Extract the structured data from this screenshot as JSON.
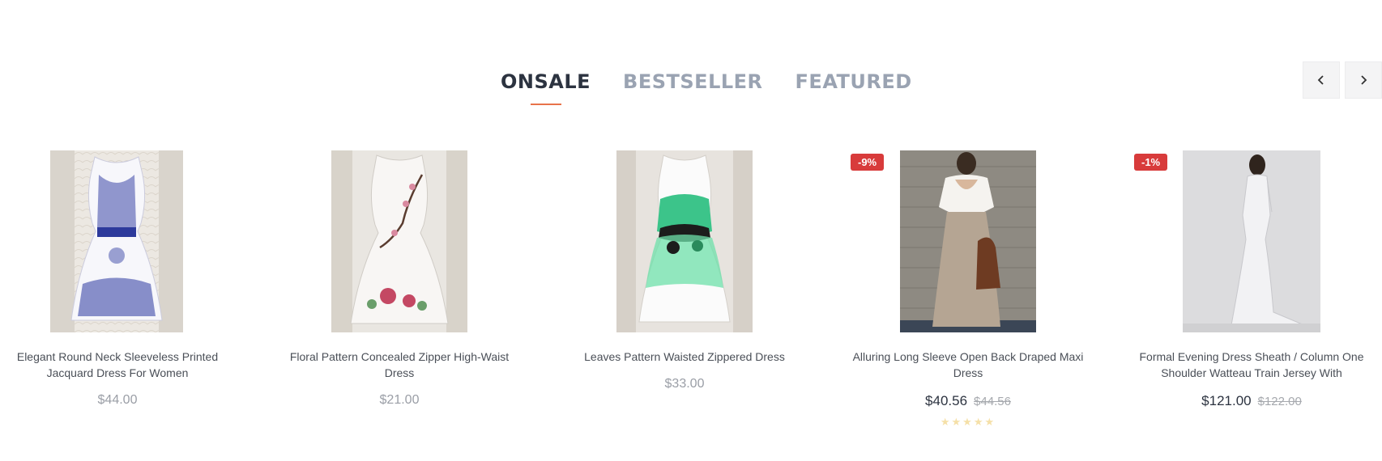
{
  "tabs": [
    {
      "label": "ONSALE",
      "active": true
    },
    {
      "label": "BESTSELLER",
      "active": false
    },
    {
      "label": "FEATURED",
      "active": false
    }
  ],
  "nav": {
    "prev_icon": "chevron-left-icon",
    "next_icon": "chevron-right-icon"
  },
  "colors": {
    "accent": "#e8734a",
    "badge": "#d83b3b",
    "tab_active": "#2c3340",
    "tab_inactive": "#9aa3b2"
  },
  "products": [
    {
      "name_line1": "Elegant Round Neck Sleeveless Printed",
      "name_line2": "Jacquard Dress For Women",
      "price": "$44.00",
      "old_price": "",
      "badge": ""
    },
    {
      "name_line1": "Floral Pattern Concealed Zipper High-Waist",
      "name_line2": "Dress",
      "price": "$21.00",
      "old_price": "",
      "badge": ""
    },
    {
      "name_line1": "Leaves Pattern Waisted Zippered Dress",
      "name_line2": "",
      "price": "$33.00",
      "old_price": "",
      "badge": ""
    },
    {
      "name_line1": "Alluring Long Sleeve Open Back Draped Maxi",
      "name_line2": "Dress",
      "price": "$40.56",
      "old_price": "$44.56",
      "badge": "-9%",
      "stars": "★★★★★"
    },
    {
      "name_line1": "Formal Evening Dress Sheath / Column One",
      "name_line2": "Shoulder Watteau Train Jersey With",
      "price": "$121.00",
      "old_price": "$122.00",
      "badge": "-1%"
    }
  ]
}
